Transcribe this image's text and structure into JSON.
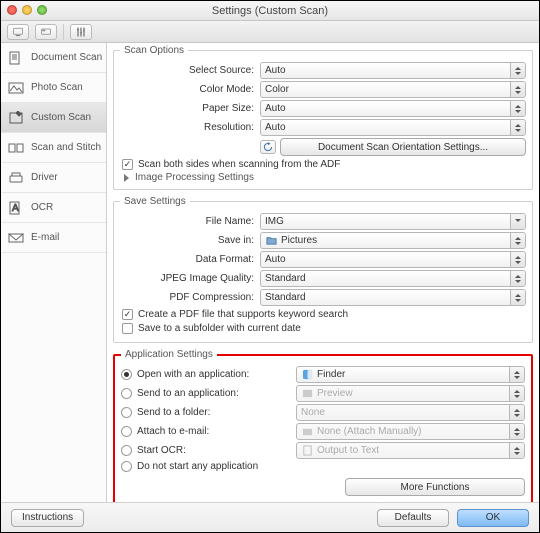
{
  "window": {
    "title": "Settings (Custom Scan)"
  },
  "sidebar": {
    "items": [
      {
        "label": "Document Scan"
      },
      {
        "label": "Photo Scan"
      },
      {
        "label": "Custom Scan"
      },
      {
        "label": "Scan and Stitch"
      },
      {
        "label": "Driver"
      },
      {
        "label": "OCR"
      },
      {
        "label": "E-mail"
      }
    ]
  },
  "scan_options": {
    "legend": "Scan Options",
    "select_source": {
      "label": "Select Source:",
      "value": "Auto"
    },
    "color_mode": {
      "label": "Color Mode:",
      "value": "Color"
    },
    "paper_size": {
      "label": "Paper Size:",
      "value": "Auto"
    },
    "resolution": {
      "label": "Resolution:",
      "value": "Auto"
    },
    "orientation_btn": "Document Scan Orientation Settings...",
    "scan_both_sides": "Scan both sides when scanning from the ADF",
    "image_processing": "Image Processing Settings"
  },
  "save_settings": {
    "legend": "Save Settings",
    "file_name": {
      "label": "File Name:",
      "value": "IMG"
    },
    "save_in": {
      "label": "Save in:",
      "value": "Pictures"
    },
    "data_format": {
      "label": "Data Format:",
      "value": "Auto"
    },
    "jpeg_quality": {
      "label": "JPEG Image Quality:",
      "value": "Standard"
    },
    "pdf_compression": {
      "label": "PDF Compression:",
      "value": "Standard"
    },
    "create_pdf": "Create a PDF file that supports keyword search",
    "subfolder": "Save to a subfolder with current date"
  },
  "app_settings": {
    "legend": "Application Settings",
    "open_app": {
      "label": "Open with an application:",
      "value": "Finder"
    },
    "send_app": {
      "label": "Send to an application:",
      "value": "Preview"
    },
    "send_folder": {
      "label": "Send to a folder:",
      "value": "None"
    },
    "attach_email": {
      "label": "Attach to e-mail:",
      "value": "None (Attach Manually)"
    },
    "start_ocr": {
      "label": "Start OCR:",
      "value": "Output to Text"
    },
    "do_not_start": "Do not start any application",
    "more_functions": "More Functions"
  },
  "footer": {
    "instructions": "Instructions",
    "defaults": "Defaults",
    "ok": "OK"
  }
}
